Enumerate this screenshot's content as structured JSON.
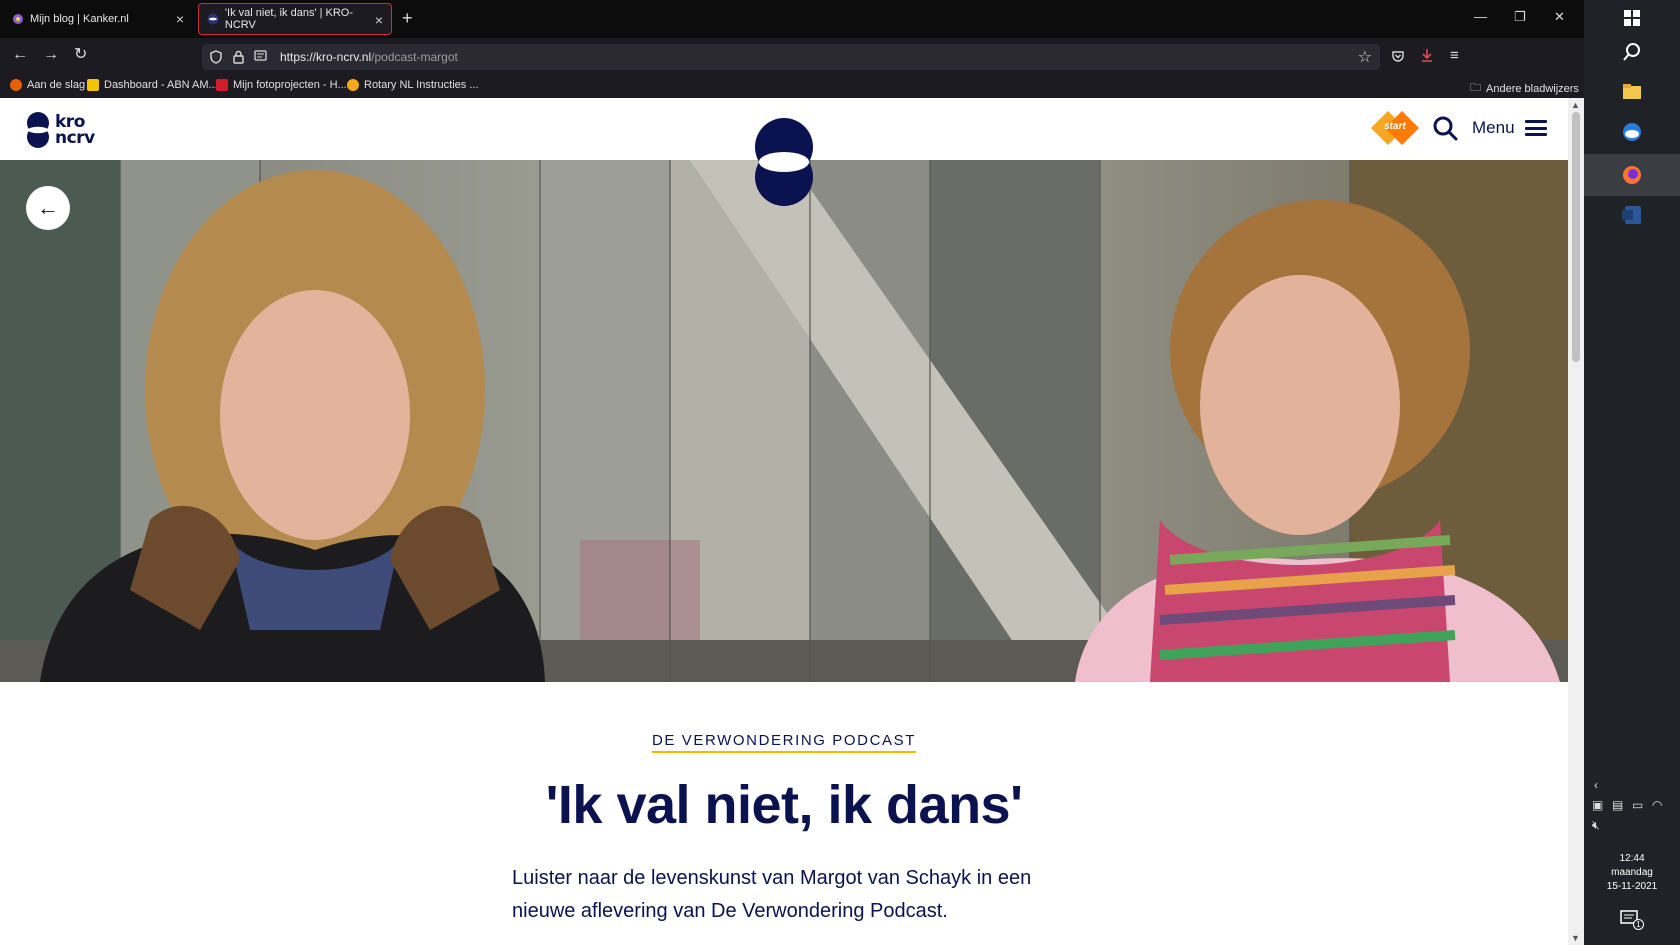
{
  "browser": {
    "tabs": [
      {
        "title": "Mijn blog | Kanker.nl",
        "active": false
      },
      {
        "title": "'Ik val niet, ik dans' | KRO-NCRV",
        "active": true
      }
    ],
    "url_host": "https://kro-ncrv.nl",
    "url_path": "/podcast-margot",
    "bookmarks": [
      "Aan de slag",
      "Dashboard - ABN AM...",
      "Mijn fotoprojecten - H...",
      "Rotary NL Instructies ..."
    ],
    "other_bookmarks": "Andere bladwijzers"
  },
  "site": {
    "logo_line1": "kro",
    "logo_line2": "ncrv",
    "npo_badge": "start",
    "menu_label": "Menu"
  },
  "article": {
    "kicker": "DE VERWONDERING PODCAST",
    "title": "'Ik val niet, ik dans'",
    "intro": "Luister naar de levenskunst van Margot van Schayk in een nieuwe aflevering van De Verwondering Podcast."
  },
  "taskbar": {
    "time": "12:44",
    "day": "maandag",
    "date": "15-11-2021",
    "notification_count": "1"
  },
  "colors": {
    "brand_navy": "#0b1250",
    "kicker_underline": "#f5b800",
    "tab_active_border": "#d12b3a"
  }
}
